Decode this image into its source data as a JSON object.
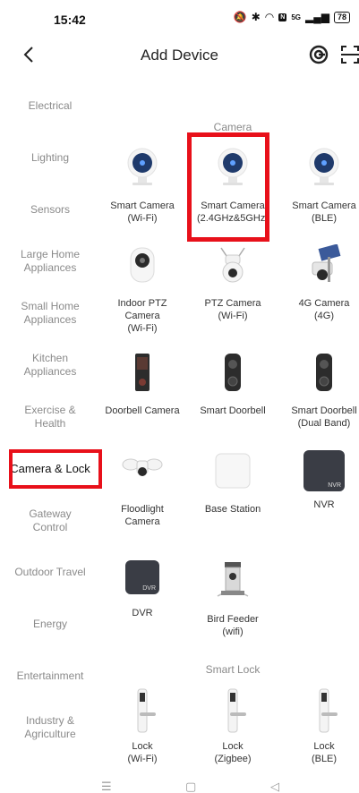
{
  "status": {
    "time": "15:42",
    "network": "5G",
    "battery": "78"
  },
  "header": {
    "title": "Add Device"
  },
  "sidebar": {
    "items": [
      {
        "label": "Electrical"
      },
      {
        "label": "Lighting"
      },
      {
        "label": "Sensors"
      },
      {
        "label": "Large Home Appliances"
      },
      {
        "label": "Small Home Appliances"
      },
      {
        "label": "Kitchen Appliances"
      },
      {
        "label": "Exercise & Health"
      },
      {
        "label": "Camera & Lock"
      },
      {
        "label": "Gateway Control"
      },
      {
        "label": "Outdoor Travel"
      },
      {
        "label": "Energy"
      },
      {
        "label": "Entertainment"
      },
      {
        "label": "Industry & Agriculture"
      }
    ],
    "selected": "Camera & Lock"
  },
  "sections": {
    "camera": "Camera",
    "smart_lock": "Smart Lock"
  },
  "devices": {
    "smart_camera_wifi": {
      "line1": "Smart Camera",
      "line2": "(Wi-Fi)"
    },
    "smart_camera_dual": {
      "line1": "Smart Camera",
      "line2": "(2.4GHz&5GHz)"
    },
    "smart_camera_ble": {
      "line1": "Smart Camera",
      "line2": "(BLE)"
    },
    "indoor_ptz": {
      "line1": "Indoor PTZ",
      "line2": "Camera",
      "line3": "(Wi-Fi)"
    },
    "ptz_camera": {
      "line1": "PTZ Camera",
      "line2": "(Wi-Fi)"
    },
    "camera_4g": {
      "line1": "4G Camera",
      "line2": "(4G)"
    },
    "doorbell_camera": {
      "line1": "Doorbell Camera"
    },
    "smart_doorbell": {
      "line1": "Smart Doorbell"
    },
    "smart_doorbell_dual": {
      "line1": "Smart Doorbell",
      "line2": "(Dual Band)"
    },
    "floodlight": {
      "line1": "Floodlight",
      "line2": "Camera"
    },
    "base_station": {
      "line1": "Base Station"
    },
    "nvr": {
      "line1": "NVR",
      "badge": "NVR"
    },
    "dvr": {
      "line1": "DVR",
      "badge": "DVR"
    },
    "bird_feeder": {
      "line1": "Bird Feeder",
      "line2": "(wifi)"
    },
    "lock_wifi": {
      "line1": "Lock",
      "line2": "(Wi-Fi)"
    },
    "lock_zigbee": {
      "line1": "Lock",
      "line2": "(Zigbee)"
    },
    "lock_ble": {
      "line1": "Lock",
      "line2": "(BLE)"
    }
  },
  "colors": {
    "highlight": "#e8101a",
    "camera_lens": "#1f3a6b"
  }
}
